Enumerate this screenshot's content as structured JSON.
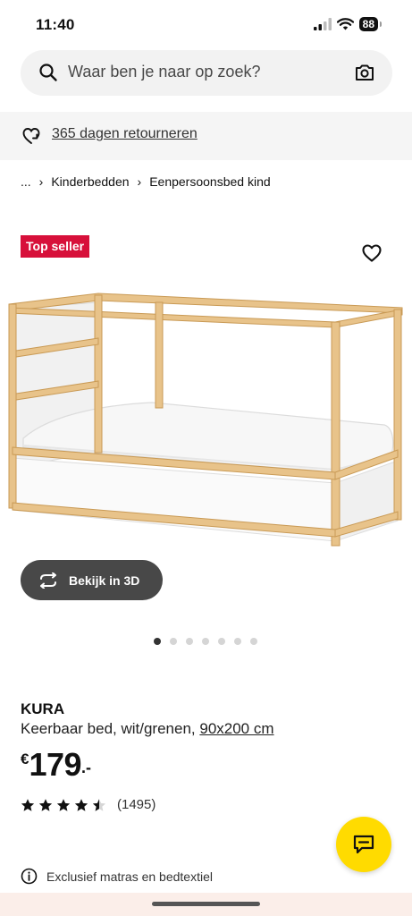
{
  "status_bar": {
    "time": "11:40",
    "battery": "88",
    "icons": [
      "signal-icon",
      "wifi-icon",
      "battery-icon"
    ]
  },
  "search": {
    "placeholder": "Waar ben je naar op zoek?",
    "icons": [
      "search-icon",
      "camera-icon"
    ]
  },
  "returns": {
    "label": "365 dagen retourneren",
    "icon": "returns-icon"
  },
  "breadcrumb": {
    "items": [
      "...",
      "Kinderbedden",
      "Eenpersoonsbed kind"
    ],
    "separator": "›"
  },
  "product": {
    "badge": "Top seller",
    "badge_color": "#d7103a",
    "view_3d_label": "Bekijk in 3D",
    "image_count": 7,
    "active_image_index": 0,
    "name": "KURA",
    "description": "Keerbaar bed, wit/grenen,",
    "size": "90x200 cm",
    "price": {
      "currency": "€",
      "amount": "179",
      "suffix": ".-"
    },
    "rating": {
      "value": 4.5,
      "max": 5,
      "count": "(1495)"
    },
    "info": "Exclusief matras en bedtextiel"
  },
  "colors": {
    "accent_yellow": "#ffdb00",
    "button_dark": "#484848",
    "search_bg": "#f2f2f2"
  }
}
